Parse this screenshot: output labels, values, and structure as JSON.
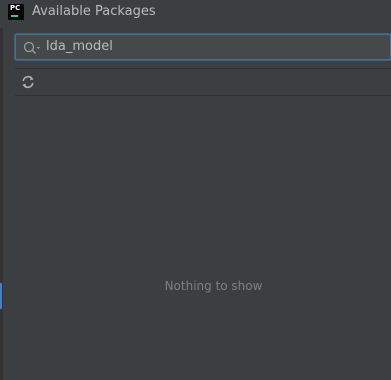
{
  "window": {
    "title": "Available Packages",
    "app_icon_text": "PC"
  },
  "search": {
    "value": "lda_model",
    "icon": "search-icon"
  },
  "toolbar": {
    "refresh_icon": "refresh-icon"
  },
  "content": {
    "empty_text": "Nothing to show"
  },
  "colors": {
    "background": "#3c3f41",
    "search_border": "#466d94",
    "text": "#bbbbbb",
    "muted_text": "#7d7f81"
  }
}
